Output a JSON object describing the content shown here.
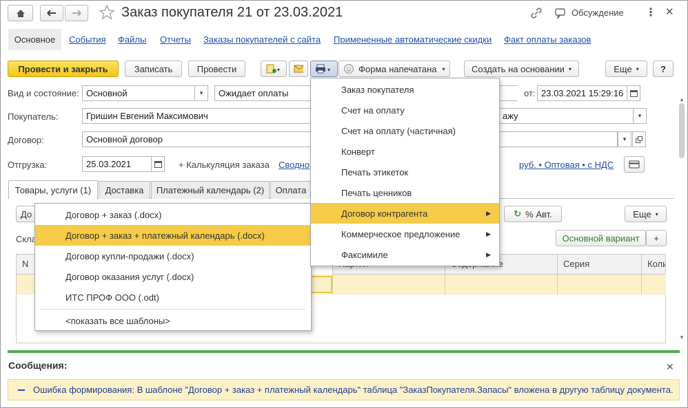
{
  "window": {
    "title": "Заказ покупателя 21 от 23.03.2021",
    "discussion": "Обсуждение"
  },
  "nav_tabs": [
    "Основное",
    "События",
    "Файлы",
    "Отчеты",
    "Заказы покупателей с сайта",
    "Примененные автоматические скидки",
    "Факт оплаты заказов"
  ],
  "toolbar": {
    "post_close": "Провести и закрыть",
    "save": "Записать",
    "post": "Провести",
    "printed_form": "Форма напечатана",
    "create_based": "Создать на основании",
    "more": "Еще",
    "help": "?"
  },
  "form": {
    "kind_label": "Вид и состояние:",
    "kind_value": "Основной",
    "state_value": "Ожидает оплаты",
    "date_label": "от:",
    "date_value": "23.03.2021 15:29:16",
    "buyer_label": "Покупатель:",
    "buyer_value": "Гришин Евгений Максимович",
    "buyer_right": "ажу",
    "contract_label": "Договор:",
    "contract_value": "Основной договор",
    "shipment_label": "Отгрузка:",
    "shipment_value": "25.03.2021",
    "calc_label": "+ Калькуляция заказа",
    "summary_link": "Сводно",
    "price_link": "руб. • Оптовая • с НДС"
  },
  "content_tabs": [
    "Товары, услуги (1)",
    "Доставка",
    "Платежный календарь (2)",
    "Оплата"
  ],
  "content": {
    "btn_do": "До",
    "avt": "% Авт.",
    "more": "Еще",
    "sklad": "Скла",
    "main_variant": "Основной вариант",
    "plus": "+",
    "columns": [
      "N",
      "Партия",
      "Содержание",
      "Серия",
      "Коли"
    ]
  },
  "print_menu": {
    "items": [
      "Заказ покупателя",
      "Счет на оплату",
      "Счет на оплату (частичная)",
      "Конверт",
      "Печать этикеток",
      "Печать ценников",
      "Договор контрагента",
      "Коммерческое предложение",
      "Факсимиле"
    ]
  },
  "submenu": {
    "items": [
      "Договор + заказ (.docx)",
      "Договор + заказ + платежный календарь (.docx)",
      "Договор купли-продажи (.docx)",
      "Договор оказания услуг (.docx)",
      "ИТС ПРОФ ООО (.odt)"
    ],
    "show_all": "<показать все шаблоны>"
  },
  "messages": {
    "title": "Сообщения:",
    "text": "Ошибка формирования: В шаблоне \"Договор + заказ + платежный календарь\" таблица \"ЗаказПокупателя.Запасы\" вложена в другую таблицу документа."
  },
  "colors": {
    "accent_yellow": "#f5cb47",
    "link_blue": "#1f4fb0",
    "green_bar": "#4caf50",
    "message_bg": "#fcf1c7"
  }
}
